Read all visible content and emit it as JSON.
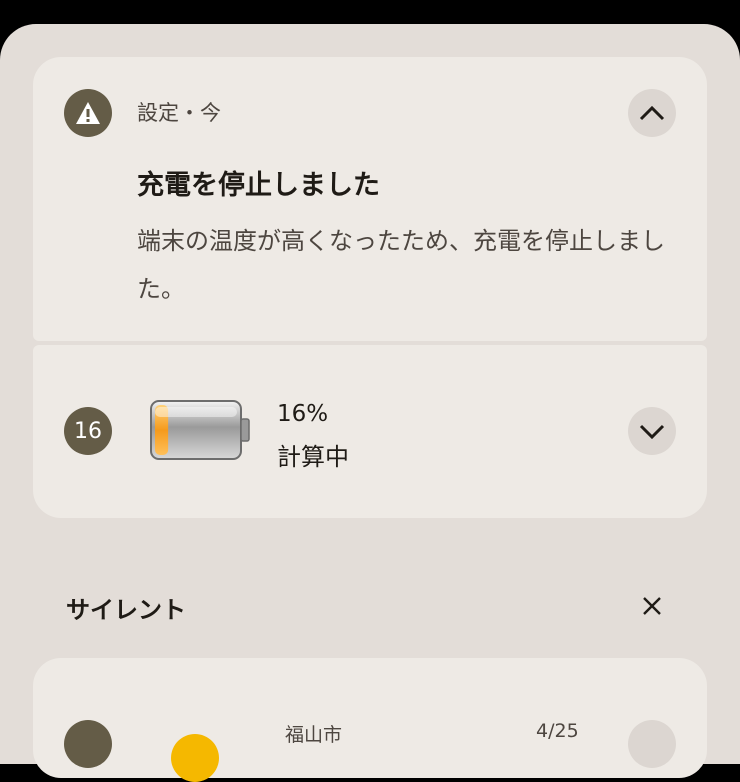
{
  "notifications": [
    {
      "app_meta": "設定・今",
      "title": "充電を停止しました",
      "body": "端末の温度が高くなったため、充電を停止しました。",
      "icon": "warning-icon",
      "expand_icon": "chevron-up-icon"
    },
    {
      "badge": "16",
      "percent": "16%",
      "status": "計算中",
      "battery_level": 0.16,
      "icon": "battery-icon",
      "expand_icon": "chevron-down-icon"
    }
  ],
  "silent_section": {
    "title": "サイレント",
    "clear_icon": "close-icon"
  },
  "weather": {
    "city": "福山市",
    "date": "4/25",
    "icon": "sun-icon"
  },
  "colors": {
    "shade_bg": "#e3ddd8",
    "card_bg": "#eeeae5",
    "icon_bg": "#645c47",
    "accent_battery": "#f59a1c"
  }
}
